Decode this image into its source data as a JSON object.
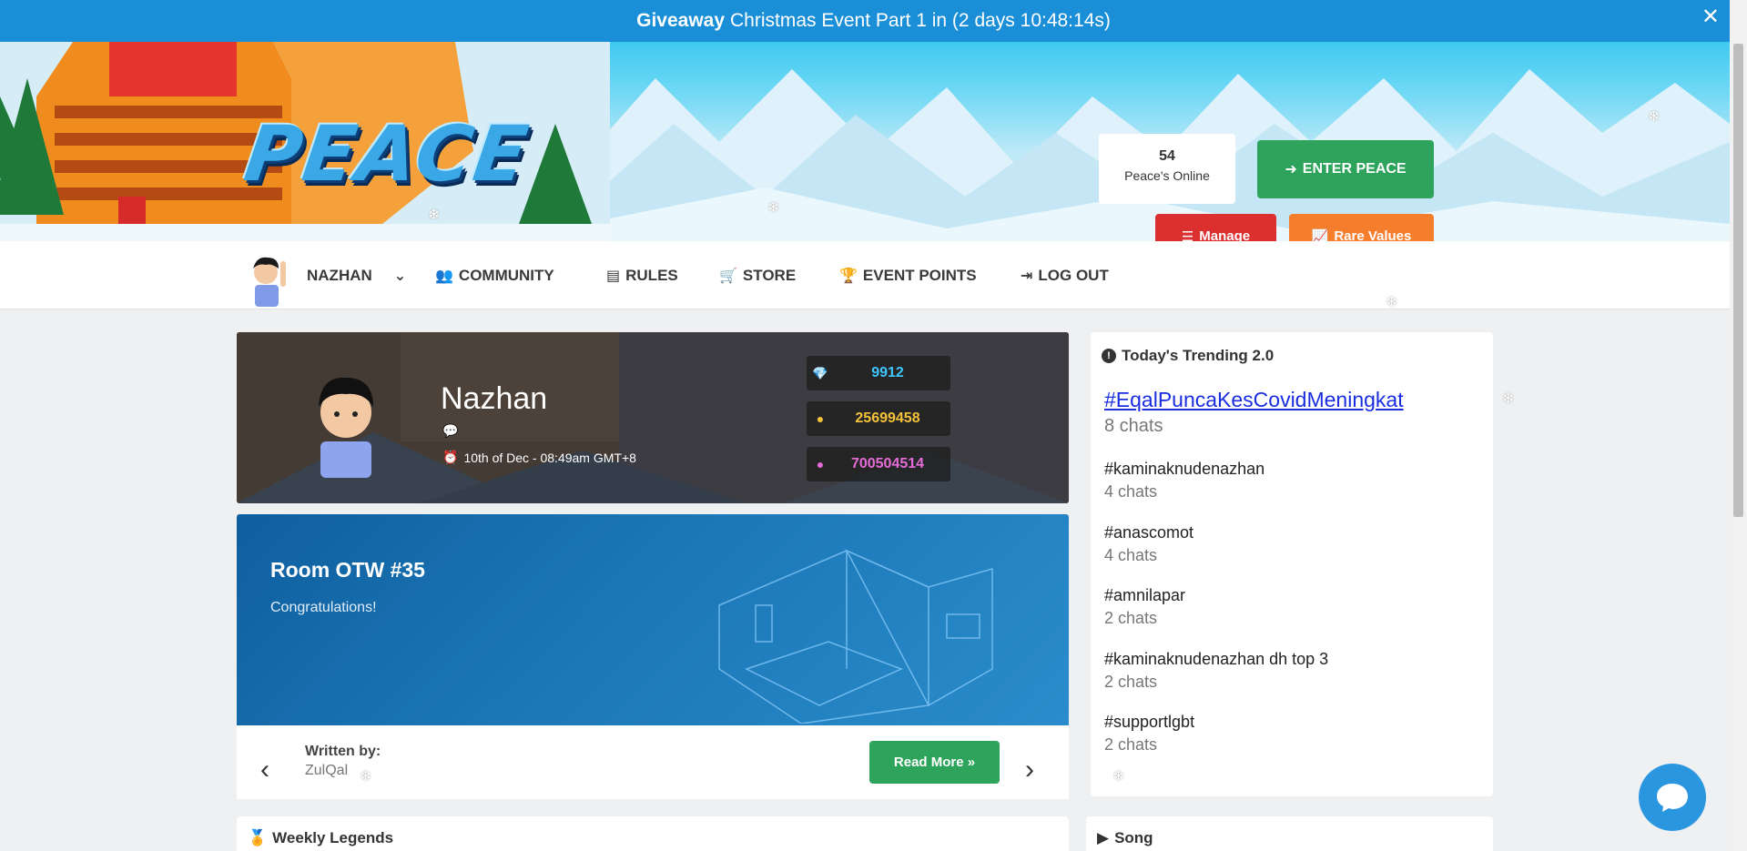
{
  "banner": {
    "bold": "Giveaway",
    "text": "Christmas Event Part 1 in (2 days 10:48:14s)",
    "close_icon": "close-icon"
  },
  "header": {
    "logo_text": "PEACE",
    "online_count": "54",
    "online_label": "Peace's Online",
    "enter_label": "ENTER PEACE",
    "manage_label": "Manage",
    "rare_label": "Rare Values",
    "colors": {
      "enter": "#2ea35b",
      "manage": "#dc2f2f",
      "rare": "#f57e2d"
    }
  },
  "nav": {
    "user": "NAZHAN",
    "items": [
      {
        "label": "COMMUNITY",
        "icon": "users-icon"
      },
      {
        "label": "RULES",
        "icon": "document-icon"
      },
      {
        "label": "STORE",
        "icon": "cart-icon"
      },
      {
        "label": "EVENT POINTS",
        "icon": "trophy-icon"
      },
      {
        "label": "LOG OUT",
        "icon": "logout-icon"
      }
    ]
  },
  "profile": {
    "name": "Nazhan",
    "last_seen": "10th of Dec - 08:49am GMT+8",
    "diamonds": "9912",
    "credits": "25699458",
    "duckets": "700504514",
    "colors": {
      "diamonds": "#3fc6ff",
      "credits": "#f4c23a",
      "duckets": "#e56bd6"
    }
  },
  "room_otw": {
    "title": "Room OTW #35",
    "subtitle": "Congratulations!",
    "written_by_label": "Written by:",
    "author": "ZulQal",
    "read_more": "Read More »"
  },
  "trending": {
    "title": "Today's Trending 2.0",
    "items": [
      {
        "tag": "#EqalPuncaKesCovidMeningkat",
        "count": "8 chats"
      },
      {
        "tag": "#kaminaknudenazhan",
        "count": "4 chats"
      },
      {
        "tag": "#anascomot",
        "count": "4 chats"
      },
      {
        "tag": "#amnilapar",
        "count": "2 chats"
      },
      {
        "tag": "#kaminaknudenazhan dh top 3",
        "count": "2 chats"
      },
      {
        "tag": "#supportlgbt",
        "count": "2 chats"
      }
    ]
  },
  "weekly": {
    "title": "Weekly Legends"
  },
  "song": {
    "title": "Song"
  }
}
